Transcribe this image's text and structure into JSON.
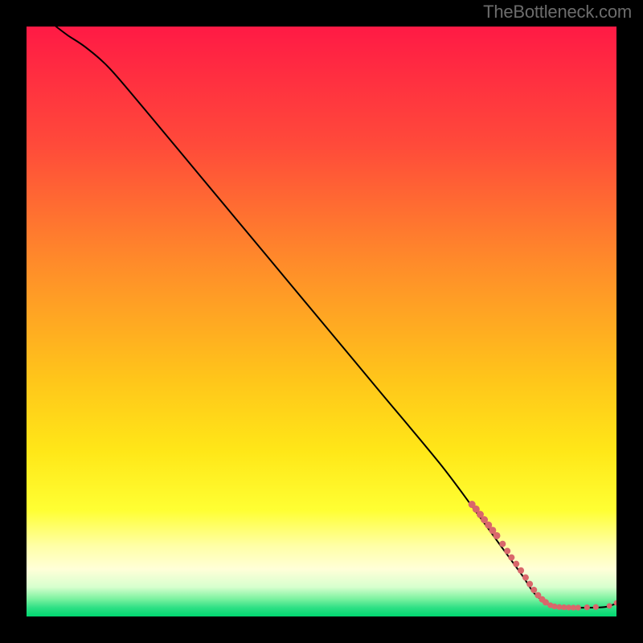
{
  "watermark": "TheBottleneck.com",
  "chart_data": {
    "type": "line",
    "title": "",
    "xlabel": "",
    "ylabel": "",
    "xlim": [
      0,
      100
    ],
    "ylim": [
      0,
      100
    ],
    "background_gradient": {
      "stops": [
        {
          "offset": 0.0,
          "color": "#ff1a45"
        },
        {
          "offset": 0.2,
          "color": "#ff4a3a"
        },
        {
          "offset": 0.4,
          "color": "#ff8b2a"
        },
        {
          "offset": 0.6,
          "color": "#ffc61a"
        },
        {
          "offset": 0.72,
          "color": "#ffe718"
        },
        {
          "offset": 0.82,
          "color": "#ffff33"
        },
        {
          "offset": 0.88,
          "color": "#ffffa6"
        },
        {
          "offset": 0.92,
          "color": "#ffffd8"
        },
        {
          "offset": 0.95,
          "color": "#d7ffce"
        },
        {
          "offset": 0.97,
          "color": "#7df2a0"
        },
        {
          "offset": 0.985,
          "color": "#2fe085"
        },
        {
          "offset": 1.0,
          "color": "#00d870"
        }
      ]
    },
    "series": [
      {
        "name": "curve",
        "type": "line",
        "color": "#000000",
        "points": [
          {
            "x": 5,
            "y": 100
          },
          {
            "x": 7,
            "y": 98.5
          },
          {
            "x": 10,
            "y": 96.5
          },
          {
            "x": 14,
            "y": 93
          },
          {
            "x": 20,
            "y": 86
          },
          {
            "x": 30,
            "y": 74
          },
          {
            "x": 40,
            "y": 62
          },
          {
            "x": 50,
            "y": 50
          },
          {
            "x": 60,
            "y": 38
          },
          {
            "x": 70,
            "y": 26
          },
          {
            "x": 76,
            "y": 18
          },
          {
            "x": 80,
            "y": 12.5
          },
          {
            "x": 84,
            "y": 7
          },
          {
            "x": 86,
            "y": 4
          },
          {
            "x": 88,
            "y": 2.3
          },
          {
            "x": 89,
            "y": 1.8
          },
          {
            "x": 90,
            "y": 1.6
          },
          {
            "x": 92,
            "y": 1.5
          },
          {
            "x": 95,
            "y": 1.5
          },
          {
            "x": 98,
            "y": 1.6
          },
          {
            "x": 100,
            "y": 2.2
          }
        ]
      },
      {
        "name": "markers",
        "type": "scatter",
        "color": "#d9676b",
        "points": [
          {
            "x": 75.5,
            "y": 19.0,
            "r": 4.5
          },
          {
            "x": 76.2,
            "y": 18.2,
            "r": 4.5
          },
          {
            "x": 76.9,
            "y": 17.3,
            "r": 4.5
          },
          {
            "x": 77.6,
            "y": 16.4,
            "r": 4.5
          },
          {
            "x": 78.3,
            "y": 15.5,
            "r": 4.5
          },
          {
            "x": 79.0,
            "y": 14.6,
            "r": 4.5
          },
          {
            "x": 79.7,
            "y": 13.7,
            "r": 4.5
          },
          {
            "x": 80.7,
            "y": 12.3,
            "r": 4.0
          },
          {
            "x": 81.5,
            "y": 11.1,
            "r": 4.0
          },
          {
            "x": 82.2,
            "y": 10.0,
            "r": 4.0
          },
          {
            "x": 83.0,
            "y": 8.9,
            "r": 4.0
          },
          {
            "x": 83.8,
            "y": 7.8,
            "r": 4.0
          },
          {
            "x": 84.6,
            "y": 6.6,
            "r": 4.0
          },
          {
            "x": 85.3,
            "y": 5.5,
            "r": 4.0
          },
          {
            "x": 86.0,
            "y": 4.5,
            "r": 4.0
          },
          {
            "x": 86.7,
            "y": 3.6,
            "r": 4.0
          },
          {
            "x": 87.4,
            "y": 2.9,
            "r": 4.0
          },
          {
            "x": 88.0,
            "y": 2.4,
            "r": 4.0
          },
          {
            "x": 88.8,
            "y": 1.9,
            "r": 3.6
          },
          {
            "x": 89.5,
            "y": 1.7,
            "r": 3.6
          },
          {
            "x": 90.3,
            "y": 1.6,
            "r": 3.6
          },
          {
            "x": 91.1,
            "y": 1.55,
            "r": 3.6
          },
          {
            "x": 91.9,
            "y": 1.52,
            "r": 3.6
          },
          {
            "x": 92.7,
            "y": 1.5,
            "r": 3.6
          },
          {
            "x": 93.5,
            "y": 1.5,
            "r": 3.6
          },
          {
            "x": 95.0,
            "y": 1.55,
            "r": 3.6
          },
          {
            "x": 96.5,
            "y": 1.6,
            "r": 3.6
          },
          {
            "x": 98.8,
            "y": 1.8,
            "r": 3.4
          },
          {
            "x": 100.0,
            "y": 2.3,
            "r": 3.4
          }
        ]
      }
    ]
  }
}
